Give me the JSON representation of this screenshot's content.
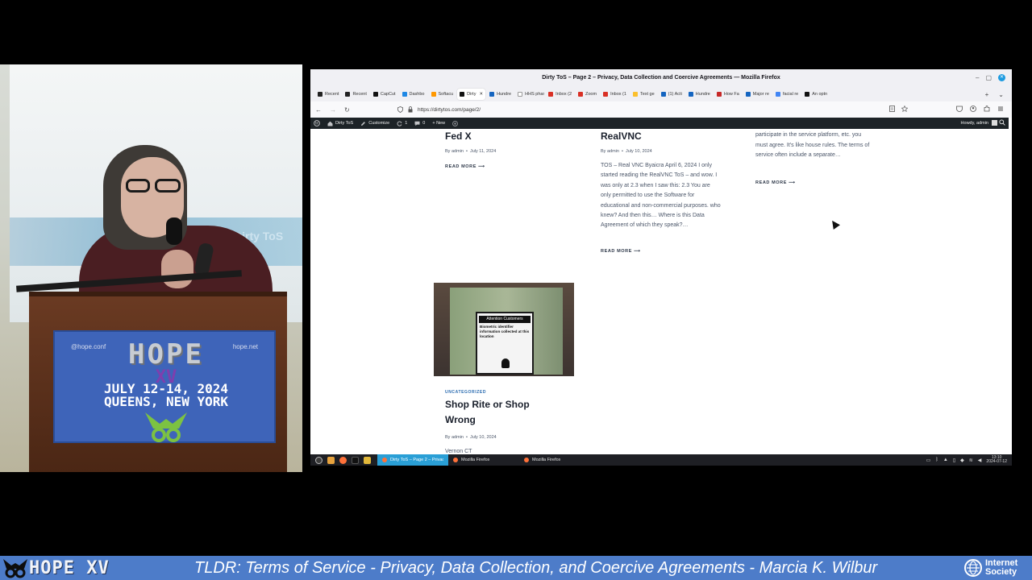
{
  "camera": {
    "projection_text": "Dirty ToS",
    "podium_sign": {
      "logo": "HOPE",
      "edition": "XV",
      "handle_left": "@hope.conf",
      "handle_right": "hope.net",
      "date_line": "JULY 12-14, 2024",
      "place_line": "QUEENS, NEW YORK"
    }
  },
  "firefox": {
    "window_title": "Dirty ToS – Page 2 – Privacy, Data Collection and Coercive Agreements — Mozilla Firefox",
    "tabs": [
      {
        "label": "Recent",
        "color": "#222"
      },
      {
        "label": "Recent",
        "color": "#222"
      },
      {
        "label": "CapCut",
        "color": "#111"
      },
      {
        "label": "Dashbo",
        "color": "#1e88e5"
      },
      {
        "label": "Softacu",
        "color": "#ff9800"
      },
      {
        "label": "Dirty",
        "color": "#111",
        "active": true
      },
      {
        "label": "Hundre",
        "color": "#1565c0"
      },
      {
        "label": "HHS pharm",
        "color": "#fff"
      },
      {
        "label": "Inbox (2",
        "color": "#d93025"
      },
      {
        "label": "Zoom",
        "color": "#d93025"
      },
      {
        "label": "Inbox (1",
        "color": "#d93025"
      },
      {
        "label": "Text ge",
        "color": "#fbc02d"
      },
      {
        "label": "(1) Acti",
        "color": "#1565c0"
      },
      {
        "label": "Hundre",
        "color": "#1565c0"
      },
      {
        "label": "How Fa",
        "color": "#c62828"
      },
      {
        "label": "Major re",
        "color": "#1565c0"
      },
      {
        "label": "facial re",
        "color": "#4285f4"
      },
      {
        "label": "An optn",
        "color": "#111"
      }
    ],
    "url": "https://dirtytos.com/page/2/",
    "icons": {
      "back": "←",
      "forward": "→",
      "reload": "↻",
      "new_tab": "+",
      "tab_list": "⌄",
      "minimize": "–",
      "maximize": "▢",
      "close": "✕"
    }
  },
  "wp_admin": {
    "site_name": "Dirty ToS",
    "customize": "Customize",
    "updates_count": "1",
    "comments_count": "0",
    "new": "+ New",
    "howdy": "Howdy, admin"
  },
  "posts": {
    "fedx": {
      "title": "Fed X",
      "by": "By",
      "author": "admin",
      "date": "July 11, 2024",
      "read_more": "READ MORE ⟶"
    },
    "realvnc": {
      "title": "RealVNC",
      "by": "By",
      "author": "admin",
      "date": "July 10, 2024",
      "excerpt": "TOS – Real VNC Byaicra April 6, 2024 I only started reading the RealVNC ToS – and wow. I was only at 2.3 when I saw this: 2.3 You are only permitted to use the Software for educational and non-commercial purposes. who knew? And then this… Where is this Data Agreement of which they speak?…",
      "read_more": "READ MORE ⟶"
    },
    "third": {
      "excerpt": "separate agreements in effect in order to participate in the service platform, etc. you must agree. It's like house rules. The terms of service often include a separate…",
      "read_more": "READ MORE ⟶"
    },
    "shoprite": {
      "category": "UNCATEGORIZED",
      "title": "Shop Rite or Shop Wrong",
      "by": "By",
      "author": "admin",
      "date": "July 10, 2024",
      "excerpt_start": "Vernon CT",
      "image_sign_header": "Attention Customers",
      "image_sign_text": "Biometric identifier information collected at this location"
    }
  },
  "taskbar": {
    "tasks": [
      {
        "label": "Dirty ToS – Page 2 – Privac",
        "active": true
      },
      {
        "label": "Mozilla Firefox",
        "active": false
      },
      {
        "label": "Mozilla Firefox",
        "active": false
      }
    ],
    "time": "13:10",
    "date": "2024-07-12"
  },
  "lower_third": {
    "logo": "HOPE XV",
    "title": "TLDR: Terms of Service - Privacy, Data Collection, and Coercive Agreements - Marcia K. Wilbur",
    "sponsor_line1": "Internet",
    "sponsor_line2": "Society"
  },
  "colors": {
    "lower_third_bg": "#4d7cc9",
    "wp_admin_bg": "#1d2327",
    "link_blue": "#2b6cb0",
    "taskbar_active": "#2a9fd6"
  }
}
